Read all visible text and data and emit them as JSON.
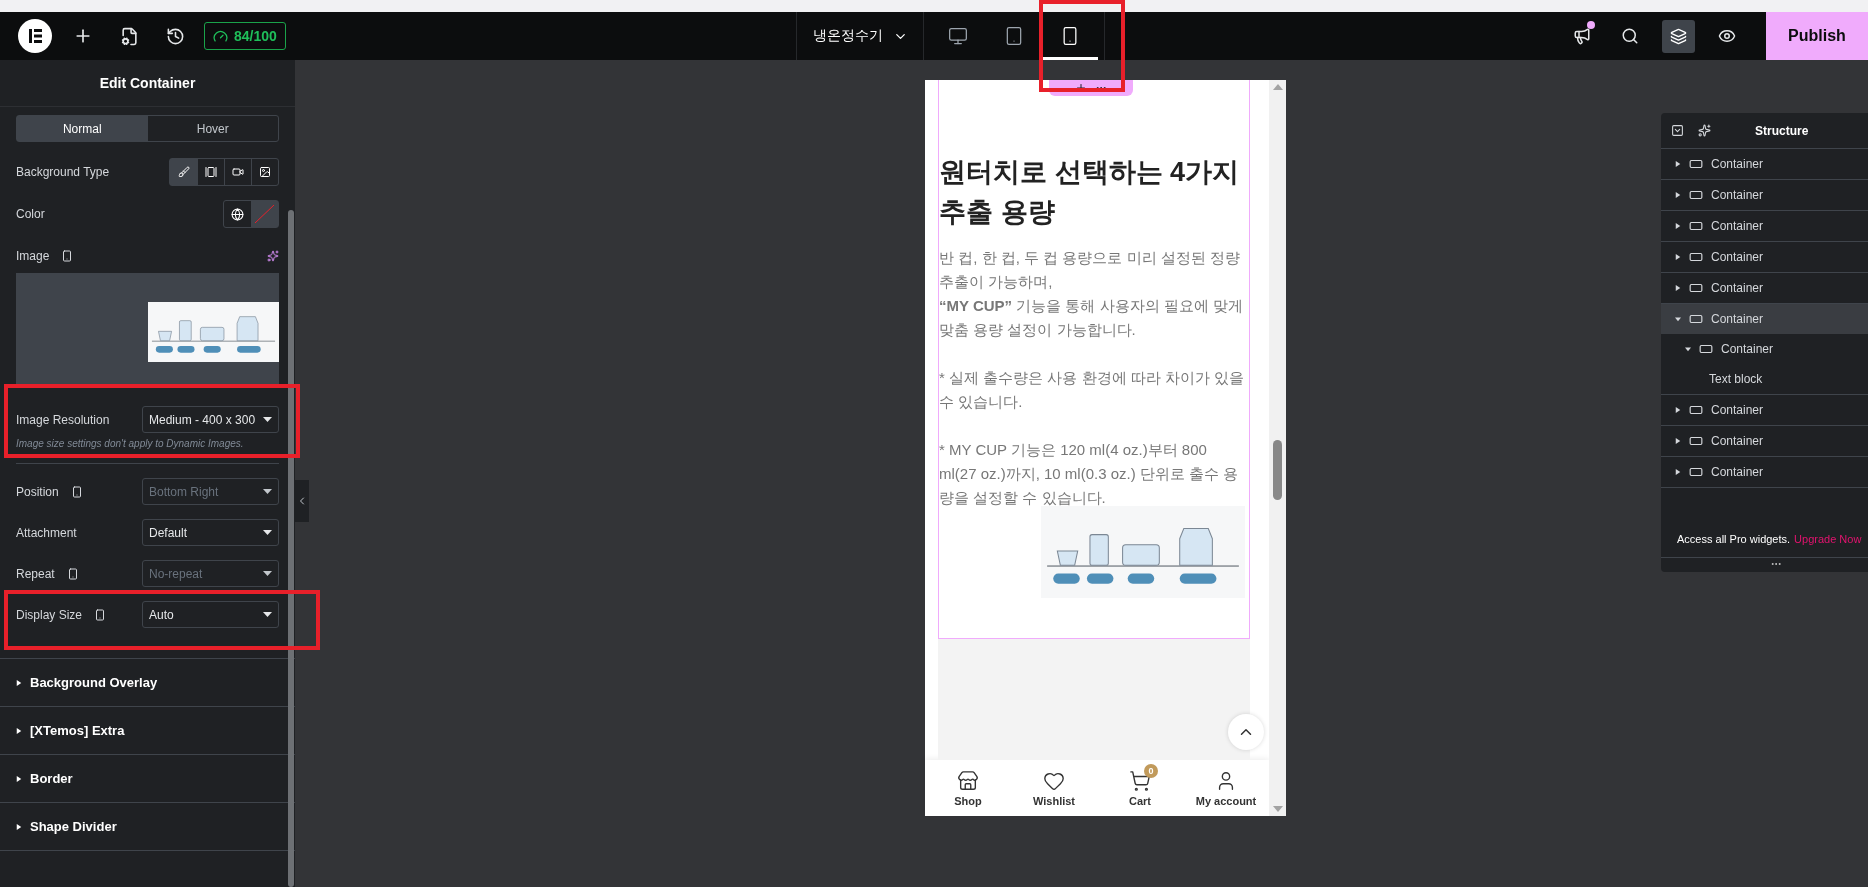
{
  "top_bar": {
    "score": "84/100",
    "page_title": "냉온정수기",
    "devices": [
      {
        "kind": "desktop",
        "selected": false
      },
      {
        "kind": "tablet",
        "selected": false
      },
      {
        "kind": "mobile",
        "selected": true
      }
    ],
    "notification": true,
    "layers_active": true,
    "publish": "Publish"
  },
  "panel": {
    "title": "Edit Container",
    "tabs": [
      {
        "label": "Normal",
        "selected": true
      },
      {
        "label": "Hover",
        "selected": false
      }
    ],
    "controls": [
      {
        "kind": "choices",
        "label": "Background Type",
        "responsive": false,
        "options": [
          {
            "kind": "classic",
            "selected": true
          },
          {
            "kind": "gradient",
            "selected": false
          },
          {
            "kind": "video",
            "selected": false
          },
          {
            "kind": "slideshow",
            "selected": false
          }
        ]
      },
      {
        "kind": "color",
        "label": "Color",
        "responsive": false
      },
      {
        "label": "Image",
        "responsive": true
      },
      {
        "kind": "select",
        "label": "Image Resolution",
        "responsive": false,
        "value": "Medium - 400 x 300",
        "note": "Image size settings don't apply to Dynamic Images."
      },
      {
        "kind": "select",
        "label": "Position",
        "responsive": true,
        "placeholder": "Bottom Right",
        "divider_before": true
      },
      {
        "kind": "select",
        "label": "Attachment",
        "responsive": false,
        "value": "Default"
      },
      {
        "kind": "select",
        "label": "Repeat",
        "responsive": true,
        "placeholder": "No-repeat"
      },
      {
        "kind": "select",
        "label": "Display Size",
        "responsive": true,
        "value": "Auto"
      }
    ],
    "sections": [
      {
        "label": "Background Overlay",
        "expanded": false
      },
      {
        "label": "[XTemos] Extra",
        "expanded": false
      },
      {
        "label": "Border",
        "expanded": false
      },
      {
        "label": "Shape Divider",
        "expanded": false
      }
    ]
  },
  "page": {
    "selected": true,
    "heading": "원터치로 선택하는 4가지 추출 용량",
    "paragraphs": [
      [
        "반 컵, 한 컵, 두 컵 용량으로 미리 설정된 정량 추출이 가능하며,",
        "**“MY CUP”** 기능을 통해 사용자의 필요에 맞게 맞춤 용량 설정이 가능합니다."
      ],
      [
        "* 실제 출수량은 사용 환경에 따라 차이가 있을 수 있습니다."
      ],
      [
        "* MY CUP 기능은 120 ml(4 oz.)부터 800 ml(27 oz.)까지, 10 ml(0.3 oz.) 단위로 출수 용량을 설정할 수 있습니다."
      ]
    ],
    "nav": [
      {
        "kind": "shop",
        "label": "Shop"
      },
      {
        "kind": "wishlist",
        "label": "Wishlist"
      },
      {
        "kind": "cart",
        "label": "Cart",
        "badge": "0"
      },
      {
        "kind": "account",
        "label": "My account"
      }
    ]
  },
  "structure": {
    "title": "Structure",
    "items": [
      {
        "kind": "container",
        "label": "Container",
        "expanded": false,
        "selected": false
      },
      {
        "kind": "container",
        "label": "Container",
        "expanded": false,
        "selected": false
      },
      {
        "kind": "container",
        "label": "Container",
        "expanded": false,
        "selected": false
      },
      {
        "kind": "container",
        "label": "Container",
        "expanded": false,
        "selected": false
      },
      {
        "kind": "container",
        "label": "Container",
        "expanded": false,
        "selected": false
      },
      {
        "kind": "container",
        "label": "Container",
        "expanded": true,
        "selected": true,
        "children": [
          {
            "kind": "container",
            "label": "Container",
            "expanded": true,
            "selected": false,
            "children": [
              {
                "kind": "widget",
                "label": "Text block",
                "selected": false
              }
            ]
          }
        ]
      },
      {
        "kind": "container",
        "label": "Container",
        "expanded": false,
        "selected": false
      },
      {
        "kind": "container",
        "label": "Container",
        "expanded": false,
        "selected": false
      },
      {
        "kind": "container",
        "label": "Container",
        "expanded": false,
        "selected": false
      }
    ],
    "promo": "Access all Pro widgets.",
    "promo_link": "Upgrade Now"
  }
}
